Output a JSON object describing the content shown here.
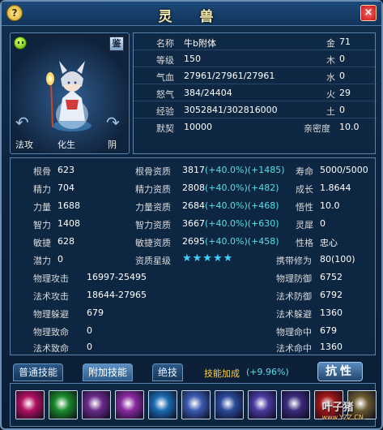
{
  "window": {
    "title": "灵 兽",
    "close_label": "×",
    "help_label": "?"
  },
  "pet": {
    "appraise_label": "鉴",
    "bottom_labels": [
      "法攻",
      "化生",
      "阴"
    ]
  },
  "info": {
    "rows": [
      {
        "label": "名称",
        "value": "牛b附体",
        "elem_label": "金",
        "elem_value": "71"
      },
      {
        "label": "等级",
        "value": "150",
        "elem_label": "木",
        "elem_value": "0"
      },
      {
        "label": "气血",
        "value": "27961/27961/27961",
        "elem_label": "水",
        "elem_value": "0"
      },
      {
        "label": "怒气",
        "value": "384/24404",
        "elem_label": "火",
        "elem_value": "29"
      },
      {
        "label": "经验",
        "value": "3052841/302816000",
        "elem_label": "土",
        "elem_value": "0"
      },
      {
        "label": "默契",
        "value": "10000",
        "elem_label": "亲密度",
        "elem_value": "10.0"
      }
    ]
  },
  "attributes": {
    "rows": [
      {
        "l1": "根骨",
        "v1": "623",
        "l2": "根骨资质",
        "v2": "3817",
        "b2": "(+40.0%)(+1485)",
        "l3": "寿命",
        "v3": "5000/5000"
      },
      {
        "l1": "精力",
        "v1": "704",
        "l2": "精力资质",
        "v2": "2808",
        "b2": "(+40.0%)(+482)",
        "l3": "成长",
        "v3": "1.8644"
      },
      {
        "l1": "力量",
        "v1": "1688",
        "l2": "力量资质",
        "v2": "2684",
        "b2": "(+40.0%)(+468)",
        "l3": "悟性",
        "v3": "10.0"
      },
      {
        "l1": "智力",
        "v1": "1408",
        "l2": "智力资质",
        "v2": "3667",
        "b2": "(+40.0%)(+630)",
        "l3": "灵犀",
        "v3": "0"
      },
      {
        "l1": "敏捷",
        "v1": "628",
        "l2": "敏捷资质",
        "v2": "2695",
        "b2": "(+40.0%)(+458)",
        "l3": "性格",
        "v3": "忠心"
      }
    ],
    "potential": {
      "label": "潜力",
      "value": "0",
      "star_label": "资质星级",
      "stars": "★★★★★",
      "carry_label": "携带修为",
      "carry_value": "80(100)"
    },
    "combat": [
      {
        "l1": "物理攻击",
        "v1": "16997-25495",
        "l2": "物理防御",
        "v2": "6752"
      },
      {
        "l1": "法术攻击",
        "v1": "18644-27965",
        "l2": "法术防御",
        "v2": "6792"
      },
      {
        "l1": "物理躲避",
        "v1": "679",
        "l2": "法术躲避",
        "v2": "1360"
      },
      {
        "l1": "物理致命",
        "v1": "0",
        "l2": "物理命中",
        "v2": "679"
      },
      {
        "l1": "法术致命",
        "v1": "0",
        "l2": "法术命中",
        "v2": "1360"
      }
    ]
  },
  "tabs": {
    "items": [
      "普通技能",
      "附加技能",
      "绝技"
    ],
    "active": "附加技能",
    "skill_bonus_label": "技能加成",
    "skill_bonus_value": "(+9.96%)",
    "resist_label": "抗性"
  },
  "skills": {
    "icons": [
      {
        "name": "skill-icon-1",
        "color": "#b01060"
      },
      {
        "name": "skill-icon-2",
        "color": "#1a8a2a"
      },
      {
        "name": "skill-icon-3",
        "color": "#6a2a8a"
      },
      {
        "name": "skill-icon-4",
        "color": "#8a2aa0"
      },
      {
        "name": "skill-icon-5",
        "color": "#1a6ab0"
      },
      {
        "name": "skill-icon-6",
        "color": "#3a5ab0"
      },
      {
        "name": "skill-icon-7",
        "color": "#2a4a9a"
      },
      {
        "name": "skill-icon-8",
        "color": "#4a3aa0"
      },
      {
        "name": "skill-icon-9",
        "color": "#3a2a7a"
      },
      {
        "name": "skill-icon-10",
        "color": "#a01818"
      },
      {
        "name": "skill-icon-11",
        "color": "#6a5a30"
      }
    ]
  },
  "watermark": {
    "brand": "叶子猪",
    "url": "www.YZZ.CN"
  }
}
